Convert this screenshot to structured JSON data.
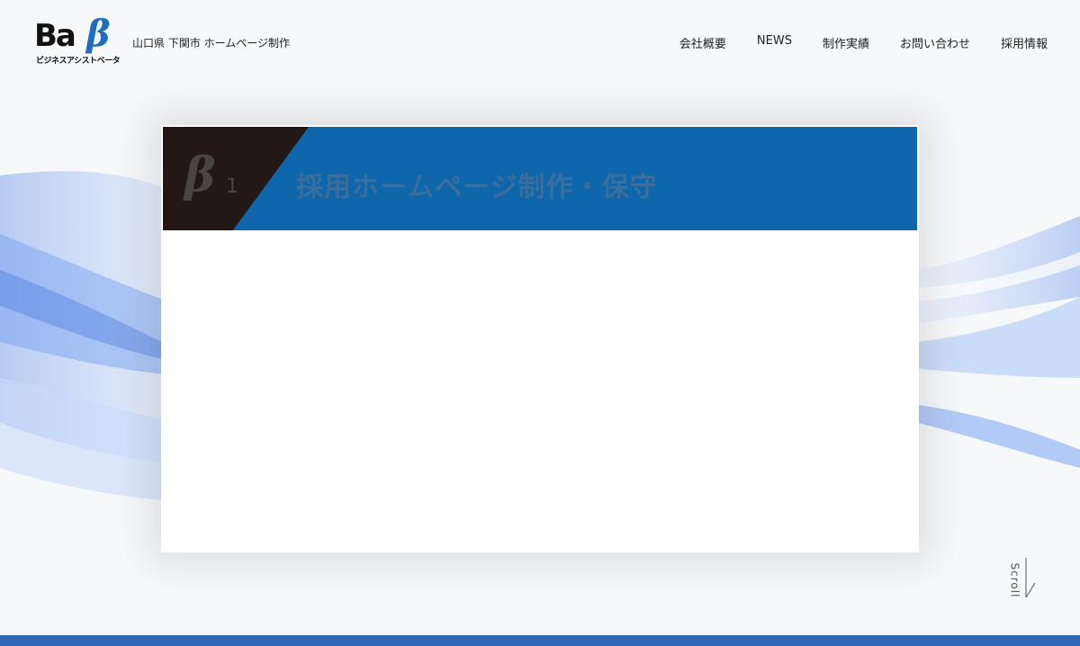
{
  "header": {
    "logo_main": "Ba",
    "logo_beta": "β",
    "logo_sub": "ビジネスアシストベータ",
    "tagline": "山口県 下関市 ホームページ制作",
    "nav": [
      {
        "label": "会社概要"
      },
      {
        "label": "NEWS"
      },
      {
        "label": "制作実績"
      },
      {
        "label": "お問い合わせ"
      },
      {
        "label": "採用情報"
      }
    ]
  },
  "card": {
    "banner_beta": "β",
    "banner_num": "1",
    "banner_title": "採用ホームページ制作・保守"
  },
  "scroll": {
    "label": "Scroll"
  },
  "colors": {
    "brand_blue": "#0f67ab",
    "banner_dark": "#231815",
    "bottom_bar": "#2f67b5"
  }
}
